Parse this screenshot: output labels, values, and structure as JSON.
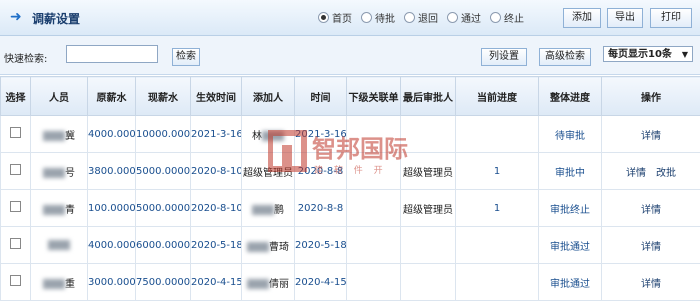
{
  "header": {
    "title": "调薪设置",
    "radios": [
      {
        "label": "首页",
        "selected": true
      },
      {
        "label": "待批",
        "selected": false
      },
      {
        "label": "退回",
        "selected": false
      },
      {
        "label": "通过",
        "selected": false
      },
      {
        "label": "终止",
        "selected": false
      }
    ],
    "add_label": "添加",
    "export_label": "导出",
    "print_label": "打印"
  },
  "search": {
    "label": "快速检索:",
    "value": "",
    "button_label": "检索",
    "columns_label": "列设置",
    "advanced_label": "高级检索",
    "page_size": "每页显示10条"
  },
  "table": {
    "headers": [
      "选择",
      "人员",
      "原薪水",
      "现薪水",
      "生效时间",
      "添加人",
      "时间",
      "下级关联单",
      "最后审批人",
      "当前进度",
      "整体进度",
      "操作"
    ],
    "rows": [
      {
        "person": "冀",
        "old": "4000.0000",
        "new": "10000.0000",
        "effective": "2021-3-16",
        "adder": "林",
        "time": "2021-3-16",
        "sub": "",
        "last_approver": "",
        "progress": "",
        "overall": "待审批",
        "actions": [
          "详情"
        ]
      },
      {
        "person": "号",
        "old": "3800.0000",
        "new": "5000.0000",
        "effective": "2020-8-10",
        "adder": "超级管理员",
        "time": "2020-8-8",
        "sub": "",
        "last_approver": "超级管理员",
        "progress": "1",
        "overall": "审批中",
        "actions": [
          "详情",
          "改批"
        ]
      },
      {
        "person": "青",
        "old": "100.0000",
        "new": "5000.0000",
        "effective": "2020-8-10",
        "adder": "鹏",
        "time": "2020-8-8",
        "sub": "",
        "last_approver": "超级管理员",
        "progress": "1",
        "overall": "审批终止",
        "actions": [
          "详情"
        ]
      },
      {
        "person": "",
        "old": "4000.0000",
        "new": "6000.0000",
        "effective": "2020-5-18",
        "adder": "曹琦",
        "time": "2020-5-18",
        "sub": "",
        "last_approver": "",
        "progress": "",
        "overall": "审批通过",
        "actions": [
          "详情"
        ]
      },
      {
        "person": "重",
        "old": "3000.0000",
        "new": "7500.0000",
        "effective": "2020-4-15",
        "adder": "倩丽",
        "time": "2020-4-15",
        "sub": "",
        "last_approver": "",
        "progress": "",
        "overall": "审批通过",
        "actions": [
          "详情"
        ]
      }
    ]
  },
  "watermark": {
    "text": "智邦国际",
    "sub": "建 软 件 开"
  },
  "colors": {
    "accent": "#1f6fc8",
    "watermark": "#c0392b"
  }
}
